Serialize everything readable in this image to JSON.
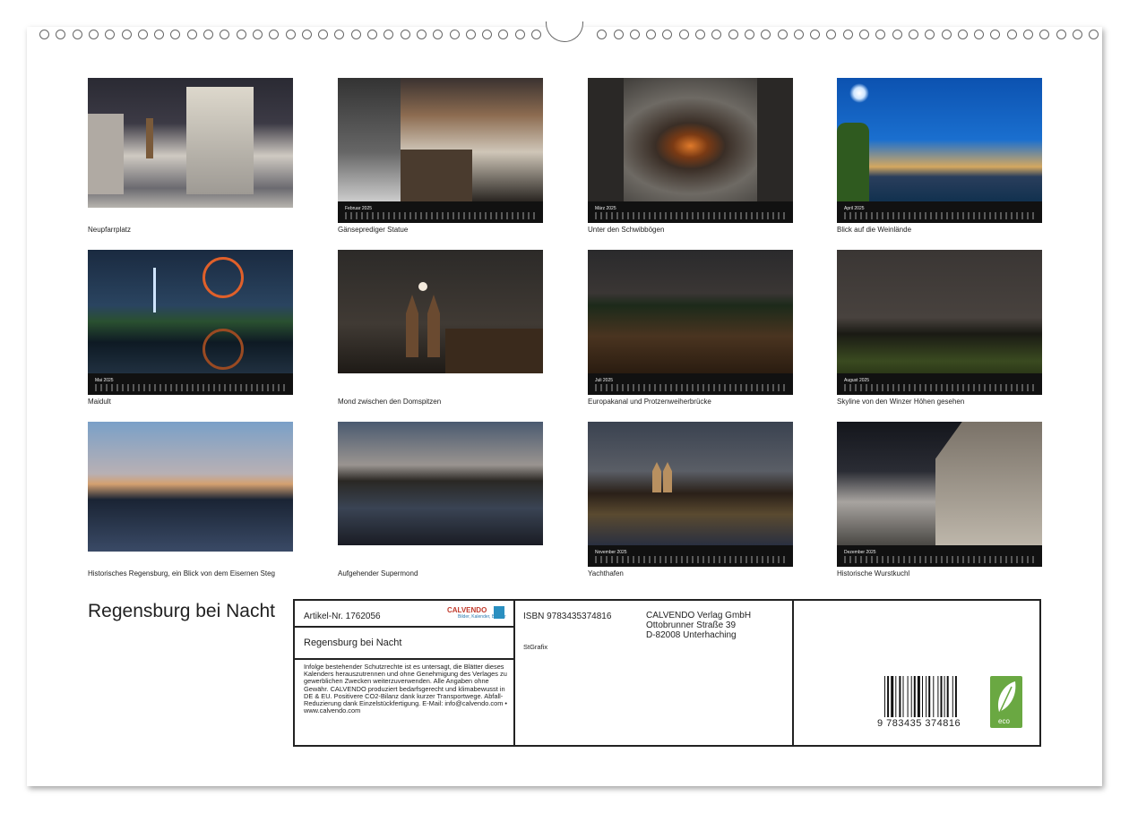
{
  "calendar": {
    "title": "Regensburg bei Nacht",
    "months": [
      {
        "caption": "Neupfarrplatz",
        "month_label": ""
      },
      {
        "caption": "Gänseprediger Statue",
        "month_label": "Februar 2025"
      },
      {
        "caption": "Unter den Schwibbögen",
        "month_label": "März 2025"
      },
      {
        "caption": "Blick auf die Weinlände",
        "month_label": "April 2025"
      },
      {
        "caption": "Maidult",
        "month_label": "Mai 2025"
      },
      {
        "caption": "Mond zwischen den Domspitzen",
        "month_label": ""
      },
      {
        "caption": "Europakanal und Protzenweiherbrücke",
        "month_label": "Juli 2025"
      },
      {
        "caption": "Skyline von den Winzer Höhen gesehen",
        "month_label": "August 2025"
      },
      {
        "caption": "Historisches Regensburg, ein Blick von dem Eisernen Steg",
        "month_label": ""
      },
      {
        "caption": "Aufgehender Supermond",
        "month_label": ""
      },
      {
        "caption": "Yachthafen",
        "month_label": "November 2025"
      },
      {
        "caption": "Historische Wurstkuchl",
        "month_label": "Dezember 2025"
      }
    ]
  },
  "info": {
    "article_no": "Artikel-Nr. 1762056",
    "logo_text": "CALVENDO",
    "logo_sub": "Bilder, Kalender, Bücher",
    "product_title": "Regensburg bei Nacht",
    "legal_text": "Infolge bestehender Schutzrechte ist es untersagt, die Blätter dieses Kalenders herauszutrennen und ohne Genehmigung des Verlages zu gewerblichen Zwecken weiterzuverwenden. Alle Angaben ohne Gewähr. CALVENDO produziert bedarfsgerecht und klimabewusst in DE & EU. Positivere CO2-Bilanz dank kurzer Transportwege. Abfall-Reduzierung dank Einzelstückfertigung. E-Mail: info@calvendo.com • www.calvendo.com",
    "isbn": "ISBN 9783435374816",
    "author": "StGrafix",
    "publisher_name": "CALVENDO Verlag GmbH",
    "publisher_street": "Ottobrunner Straße 39",
    "publisher_city": "D-82008 Unterhaching",
    "barcode_number": "9 783435 374816",
    "eco_label": "eco"
  },
  "colors": {
    "frame": "#222222",
    "eco_green": "#6aa842",
    "logo_red": "#c0392b",
    "logo_blue": "#2a8fc0"
  }
}
